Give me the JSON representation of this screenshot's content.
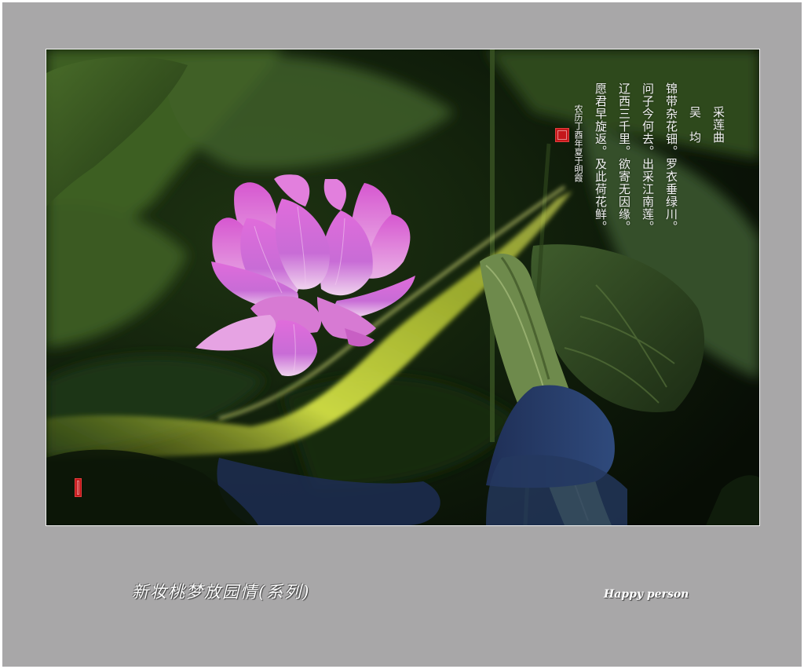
{
  "poem": {
    "title": "采莲曲",
    "author": "吴 均",
    "lines": [
      "锦带杂花钿。罗衣垂绿川。",
      "问子今何去。出采江南莲。",
      "辽西三千里。欲寄无因缘。",
      "愿君早旋返。及此荷花鲜。"
    ],
    "inscription": "农历丁酉年夏于明霞"
  },
  "captions": {
    "series_title": "新妆桃梦放园情(系列)",
    "signature": "Happy person"
  },
  "colors": {
    "frame": "#a8a7a8",
    "seal": "#c5171b",
    "lotus": "#d86fd6",
    "leaf_dark": "#13240d",
    "light_ribbon": "#d6e24a"
  }
}
